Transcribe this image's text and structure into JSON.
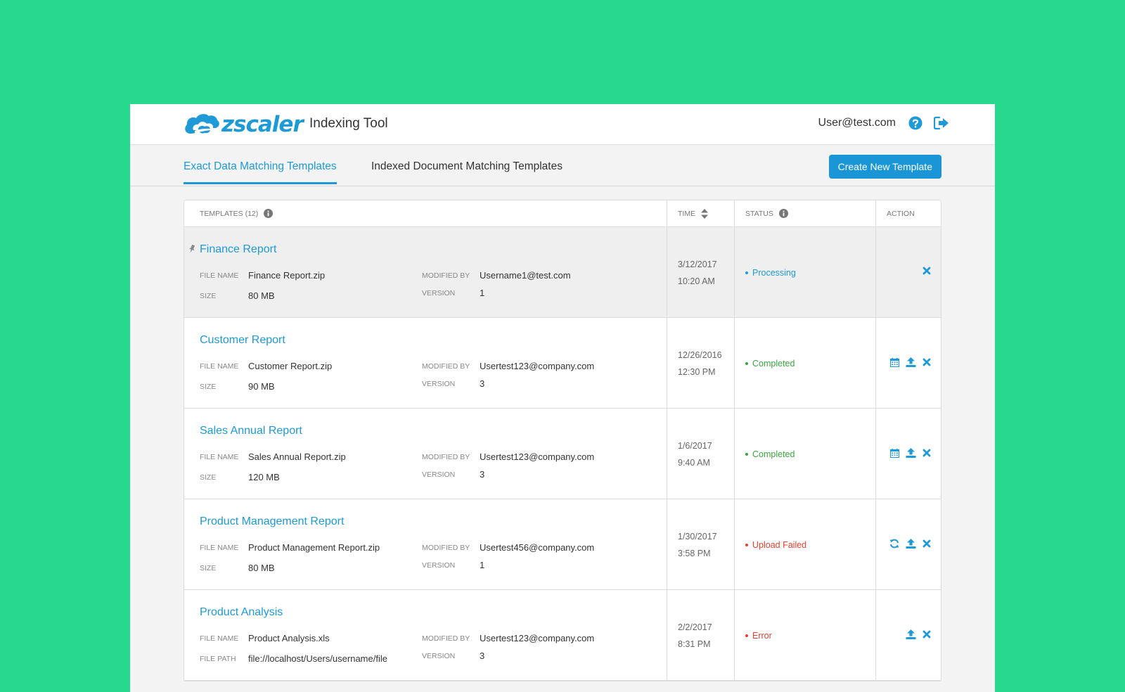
{
  "header": {
    "logo_text": "zscaler",
    "app_title": "Indexing Tool",
    "user_email": "User@test.com"
  },
  "tabs": [
    {
      "label": "Exact Data Matching Templates",
      "active": true
    },
    {
      "label": "Indexed Document Matching Templates",
      "active": false
    }
  ],
  "create_button_label": "Create New Template",
  "table": {
    "columns": {
      "templates": "TEMPLATES (12)",
      "time": "TIME",
      "status": "STATUS",
      "action": "ACTION"
    },
    "meta_labels": {
      "file_name": "FILE NAME",
      "size": "SIZE",
      "file_path": "FILE PATH",
      "modified_by": "MODIFIED BY",
      "version": "VERSION"
    },
    "rows": [
      {
        "name": "Finance Report",
        "pinned": true,
        "file_name": "Finance Report.zip",
        "second_label": "SIZE",
        "second_value": "80 MB",
        "modified_by": "Username1@test.com",
        "version": "1",
        "date": "3/12/2017",
        "time": "10:20 AM",
        "status": "Processing",
        "status_color": "#1e9ad6",
        "actions": [
          "close-icon"
        ]
      },
      {
        "name": "Customer Report",
        "pinned": false,
        "file_name": "Customer Report.zip",
        "second_label": "SIZE",
        "second_value": "90 MB",
        "modified_by": "Usertest123@company.com",
        "version": "3",
        "date": "12/26/2016",
        "time": "12:30 PM",
        "status": "Completed",
        "status_color": "#3aa540",
        "actions": [
          "calendar-icon",
          "upload-icon",
          "close-icon"
        ]
      },
      {
        "name": "Sales Annual Report",
        "pinned": false,
        "file_name": "Sales Annual Report.zip",
        "second_label": "SIZE",
        "second_value": "120 MB",
        "modified_by": "Usertest123@company.com",
        "version": "3",
        "date": "1/6/2017",
        "time": "9:40 AM",
        "status": "Completed",
        "status_color": "#3aa540",
        "actions": [
          "calendar-icon",
          "upload-icon",
          "close-icon"
        ]
      },
      {
        "name": "Product Management Report",
        "pinned": false,
        "file_name": "Product Management Report.zip",
        "second_label": "SIZE",
        "second_value": "80 MB",
        "modified_by": "Usertest456@company.com",
        "version": "1",
        "date": "1/30/2017",
        "time": "3:58 PM",
        "status": "Upload Failed",
        "status_color": "#e8402f",
        "actions": [
          "refresh-icon",
          "upload-icon",
          "close-icon"
        ]
      },
      {
        "name": "Product Analysis",
        "pinned": false,
        "file_name": "Product Analysis.xls",
        "second_label": "FILE PATH",
        "second_value": "file://localhost/Users/username/file",
        "modified_by": "Usertest123@company.com",
        "version": "3",
        "date": "2/2/2017",
        "time": "8:31 PM",
        "status": "Error",
        "status_color": "#e8402f",
        "actions": [
          "upload-icon",
          "close-icon"
        ]
      }
    ]
  },
  "colors": {
    "background": "#26d98d",
    "accent": "#1e9ad6",
    "success": "#3aa540",
    "error": "#e8402f"
  }
}
